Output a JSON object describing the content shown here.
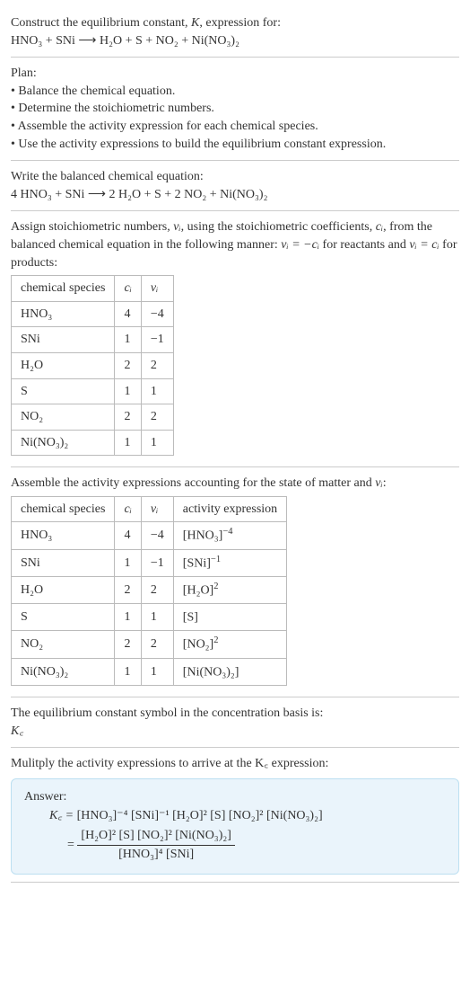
{
  "intro": {
    "line1": "Construct the equilibrium constant, ",
    "K": "K",
    "line1b": ", expression for:",
    "equation": "HNO₃ + SNi ⟶ H₂O + S + NO₂ + Ni(NO₃)₂"
  },
  "plan": {
    "heading": "Plan:",
    "items": [
      "• Balance the chemical equation.",
      "• Determine the stoichiometric numbers.",
      "• Assemble the activity expression for each chemical species.",
      "• Use the activity expressions to build the equilibrium constant expression."
    ]
  },
  "balanced": {
    "intro": "Write the balanced chemical equation:",
    "equation": "4 HNO₃ + SNi ⟶ 2 H₂O + S + 2 NO₂ + Ni(NO₃)₂"
  },
  "assign": {
    "text1": "Assign stoichiometric numbers, ",
    "nu": "νᵢ",
    "text2": ", using the stoichiometric coefficients, ",
    "ci": "cᵢ",
    "text3": ", from the balanced chemical equation in the following manner: ",
    "rel1": "νᵢ = −cᵢ",
    "text4": " for reactants and ",
    "rel2": "νᵢ = cᵢ",
    "text5": " for products:"
  },
  "table1": {
    "headers": [
      "chemical species",
      "cᵢ",
      "νᵢ"
    ],
    "rows": [
      [
        "HNO₃",
        "4",
        "−4"
      ],
      [
        "SNi",
        "1",
        "−1"
      ],
      [
        "H₂O",
        "2",
        "2"
      ],
      [
        "S",
        "1",
        "1"
      ],
      [
        "NO₂",
        "2",
        "2"
      ],
      [
        "Ni(NO₃)₂",
        "1",
        "1"
      ]
    ]
  },
  "assemble": {
    "text1": "Assemble the activity expressions accounting for the state of matter and ",
    "nu": "νᵢ",
    "text2": ":"
  },
  "table2": {
    "headers": [
      "chemical species",
      "cᵢ",
      "νᵢ",
      "activity expression"
    ],
    "rows": [
      {
        "sp": "HNO₃",
        "c": "4",
        "v": "−4",
        "expr_base": "[HNO₃]",
        "expr_sup": "−4"
      },
      {
        "sp": "SNi",
        "c": "1",
        "v": "−1",
        "expr_base": "[SNi]",
        "expr_sup": "−1"
      },
      {
        "sp": "H₂O",
        "c": "2",
        "v": "2",
        "expr_base": "[H₂O]",
        "expr_sup": "2"
      },
      {
        "sp": "S",
        "c": "1",
        "v": "1",
        "expr_base": "[S]",
        "expr_sup": ""
      },
      {
        "sp": "NO₂",
        "c": "2",
        "v": "2",
        "expr_base": "[NO₂]",
        "expr_sup": "2"
      },
      {
        "sp": "Ni(NO₃)₂",
        "c": "1",
        "v": "1",
        "expr_base": "[Ni(NO₃)₂]",
        "expr_sup": ""
      }
    ]
  },
  "basis": {
    "line1": "The equilibrium constant symbol in the concentration basis is:",
    "symbol": "K꜀"
  },
  "multiply": {
    "line": "Mulitply the activity expressions to arrive at the K꜀ expression:"
  },
  "answer": {
    "label": "Answer:",
    "lhs": "K꜀ = ",
    "flat": "[HNO₃]⁻⁴ [SNi]⁻¹ [H₂O]² [S] [NO₂]² [Ni(NO₃)₂]",
    "eq2_prefix": "= ",
    "num": "[H₂O]² [S] [NO₂]² [Ni(NO₃)₂]",
    "den": "[HNO₃]⁴ [SNi]"
  }
}
